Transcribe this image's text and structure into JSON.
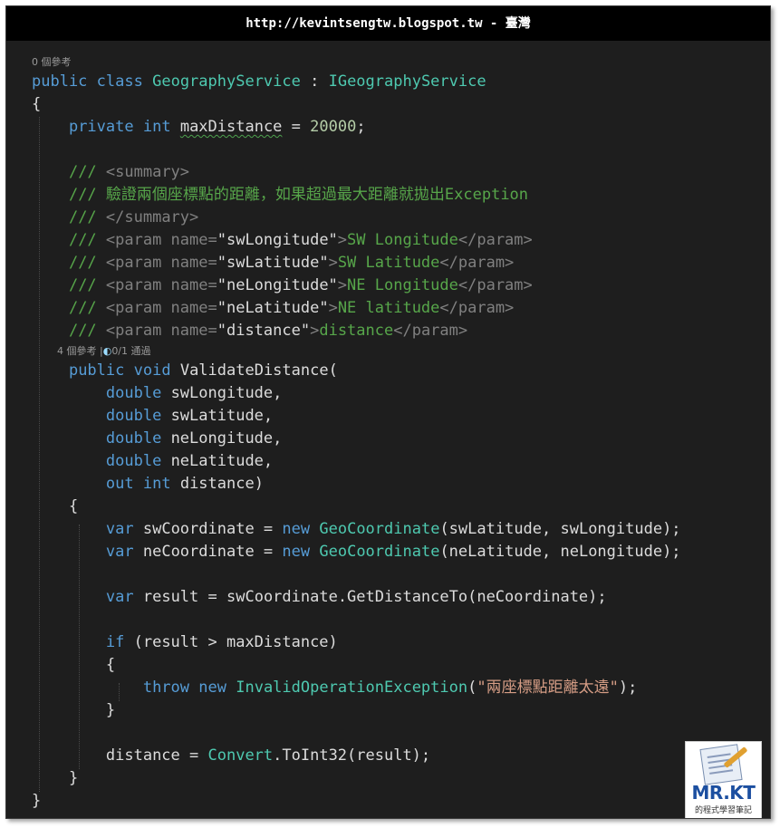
{
  "header": {
    "title": "http://kevintsengtw.blogspot.tw - 臺灣"
  },
  "codelens": {
    "class_refs": "0 個參考",
    "method_refs": "4 個參考",
    "separator": "|",
    "tests": "0/1 通過"
  },
  "code": {
    "l1_public": "public",
    "l1_class": "class",
    "l1_name": "GeographyService",
    "l1_colon": " : ",
    "l1_iface": "IGeographyService",
    "brace_open": "{",
    "brace_close": "}",
    "l3_private": "private",
    "l3_int": "int",
    "l3_field": "maxDistance",
    "l3_eq": " = ",
    "l3_num": "20000",
    "l3_semi": ";",
    "doc_slash": "/// ",
    "doc_summary_open": "<summary>",
    "doc_summary_text": "驗證兩個座標點的距離，如果超過最大距離就拋出Exception",
    "doc_summary_close": "</summary>",
    "doc_param_open": "<param name=",
    "doc_gt": ">",
    "doc_param_close": "</param>",
    "p1_name": "\"swLongitude\"",
    "p1_desc": "SW Longitude",
    "p2_name": "\"swLatitude\"",
    "p2_desc": "SW Latitude",
    "p3_name": "\"neLongitude\"",
    "p3_desc": "NE Longitude",
    "p4_name": "\"neLatitude\"",
    "p4_desc": "NE latitude",
    "p5_name": "\"distance\"",
    "p5_desc": "distance",
    "m_public": "public",
    "m_void": "void",
    "m_name": "ValidateDistance(",
    "double": "double",
    "a1": "swLongitude,",
    "a2": "swLatitude,",
    "a3": "neLongitude,",
    "a4": "neLatitude,",
    "a5_out": "out",
    "a5_int": "int",
    "a5_name": "distance)",
    "var": "var",
    "new": "new",
    "s1_var": "swCoordinate",
    "s1_type": "GeoCoordinate",
    "s1_args": "(swLatitude, swLongitude);",
    "s2_var": "neCoordinate",
    "s2_type": "GeoCoordinate",
    "s2_args": "(neLatitude, neLongitude);",
    "eq": " = ",
    "s3_var": "result",
    "s3_call": "swCoordinate.GetDistanceTo(neCoordinate);",
    "if": "if",
    "if_cond": " (result > maxDistance)",
    "throw": "throw",
    "ex_type": "InvalidOperationException",
    "ex_paren_open": "(",
    "ex_msg": "\"兩座標點距離太遠\"",
    "ex_paren_close": ");",
    "assign_target": "distance",
    "convert": "Convert",
    "convert_call": ".ToInt32(result);"
  },
  "logo": {
    "brand": "MR.KT",
    "subtitle": "的程式學習筆記"
  },
  "colors": {
    "background": "#1e1e1e",
    "keyword": "#569cd6",
    "type": "#4ec9b0",
    "comment": "#57a64a",
    "string": "#d69d85",
    "number": "#b5cea8"
  }
}
